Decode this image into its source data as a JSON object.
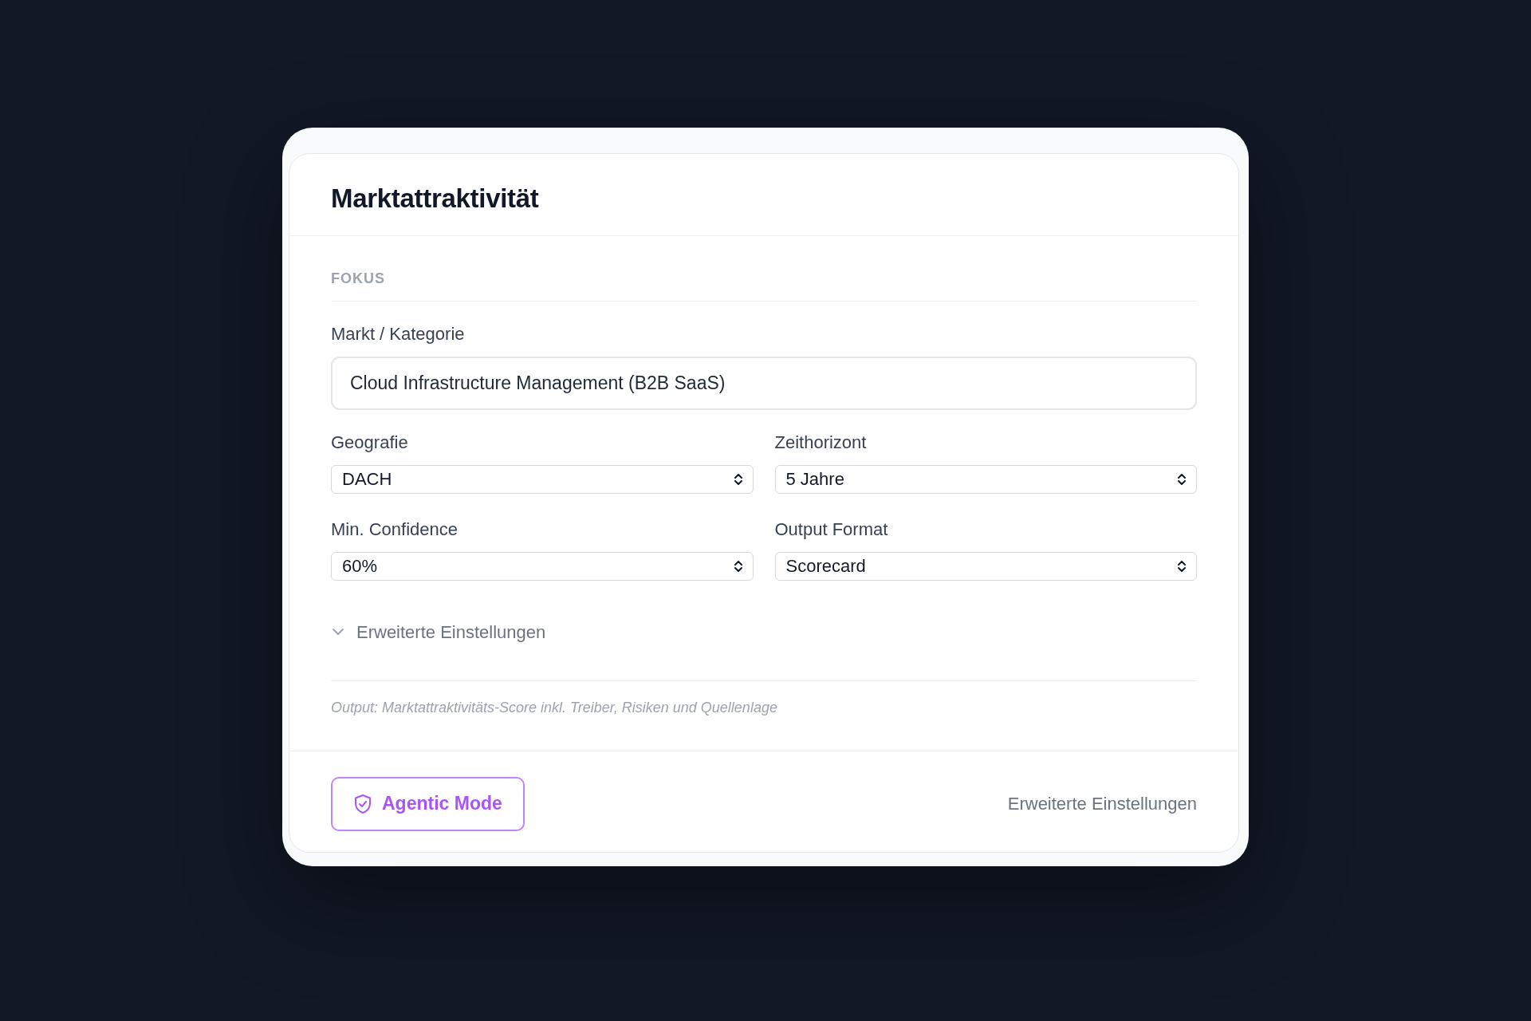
{
  "card": {
    "title": "Marktattraktivität"
  },
  "section": {
    "label": "FOKUS"
  },
  "market": {
    "label": "Markt / Kategorie",
    "value": "Cloud Infrastructure Management (B2B SaaS)"
  },
  "selects": [
    {
      "label": "Geografie",
      "value": "DACH"
    },
    {
      "label": "Zeithorizont",
      "value": "5 Jahre"
    },
    {
      "label": "Min. Confidence",
      "value": "60%"
    },
    {
      "label": "Output Format",
      "value": "Scorecard"
    }
  ],
  "advanced": {
    "label": "Erweiterte Einstellungen",
    "expanded": false
  },
  "output_note": "Output: Marktattraktivitäts-Score inkl. Treiber, Risiken und Quellenlage",
  "footer": {
    "agentic_button": "Agentic Mode",
    "settings_link": "Erweiterte Einstellungen"
  }
}
